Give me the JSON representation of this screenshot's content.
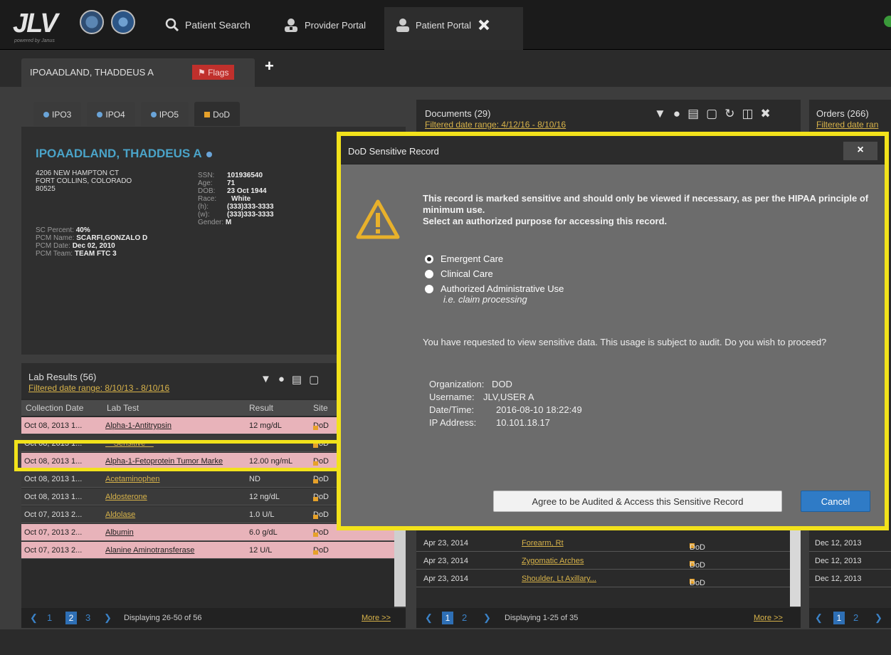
{
  "app": {
    "logo": "JLV",
    "logo_sub": "powered by Janus"
  },
  "nav": {
    "patient_search": "Patient Search",
    "provider_portal": "Provider Portal",
    "patient_portal": "Patient Portal"
  },
  "patient_tab": {
    "name": "IPOAADLAND, THADDEUS A",
    "flags": "Flags"
  },
  "source_tabs": [
    {
      "label": "IPO3"
    },
    {
      "label": "IPO4"
    },
    {
      "label": "IPO5"
    },
    {
      "label": "DoD"
    }
  ],
  "demographics": {
    "name": "IPOAADLAND, THADDEUS A",
    "address1": "4206 NEW HAMPTON CT",
    "address2": "FORT COLLINS, COLORADO",
    "zip": "80525",
    "ssn_label": "SSN:",
    "ssn": "101936540",
    "age_label": "Age:",
    "age": "71",
    "dob_label": "DOB:",
    "dob": "23 Oct 1944",
    "race_label": "Race:",
    "race": "White",
    "h_label": "(h):",
    "h": "(333)333-3333",
    "w_label": "(w):",
    "w": "(333)333-3333",
    "gender_label": "Gender:",
    "gender": "M",
    "sc_label": "SC Percent:",
    "sc": "40%",
    "pcm_name_label": "PCM Name:",
    "pcm_name": "SCARFI,GONZALO D",
    "pcm_date_label": "PCM Date:",
    "pcm_date": "Dec 02, 2010",
    "pcm_team_label": "PCM Team:",
    "pcm_team": "TEAM FTC 3"
  },
  "lab": {
    "title": "Lab Results (56)",
    "filter": "Filtered date range: 8/10/13 - 8/10/16",
    "columns": [
      "Collection Date",
      "Lab Test",
      "Result",
      "Site"
    ],
    "rows": [
      {
        "date": "Oct 08, 2013 1...",
        "test": "Alpha-1-Antitrypsin",
        "result": "12 mg/dL",
        "site": "DoD",
        "style": "pink"
      },
      {
        "date": "Oct 08, 2013 1...",
        "test": "** Sensitive **",
        "result": "",
        "site": "DoD",
        "style": "dark"
      },
      {
        "date": "Oct 08, 2013 1...",
        "test": "Alpha-1-Fetoprotein Tumor Marke",
        "result": "12.00 ng/mL",
        "site": "DoD",
        "style": "pink"
      },
      {
        "date": "Oct 08, 2013 1...",
        "test": "Acetaminophen",
        "result": "ND",
        "site": "DoD",
        "style": "dark"
      },
      {
        "date": "Oct 08, 2013 1...",
        "test": "Aldosterone",
        "result": "12 ng/dL",
        "site": "DoD",
        "style": "dark"
      },
      {
        "date": "Oct 07, 2013 2...",
        "test": "Aldolase",
        "result": "1.0 U/L",
        "site": "DoD",
        "style": "dark"
      },
      {
        "date": "Oct 07, 2013 2...",
        "test": "Albumin",
        "result": "6.0 g/dL",
        "site": "DoD",
        "style": "pink"
      },
      {
        "date": "Oct 07, 2013 2...",
        "test": "Alanine Aminotransferase",
        "result": "12 U/L",
        "site": "DoD",
        "style": "pink"
      }
    ],
    "pager": {
      "p1": "1",
      "p2": "2",
      "p3": "3",
      "display": "Displaying 26-50 of 56",
      "more": "More >>"
    }
  },
  "documents": {
    "title": "Documents (29)",
    "filter": "Filtered date range: 4/12/16 - 8/10/16",
    "rows": [
      {
        "date": "Apr 23, 2014",
        "name": "Forearm, Rt",
        "site": "DoD"
      },
      {
        "date": "Apr 23, 2014",
        "name": "Zygomatic Arches",
        "site": "DoD"
      },
      {
        "date": "Apr 23, 2014",
        "name": "Shoulder, Lt Axillary...",
        "site": "DoD"
      }
    ],
    "pager": {
      "p1": "1",
      "p2": "2",
      "display": "Displaying 1-25 of 35",
      "more": "More >>"
    }
  },
  "orders": {
    "title": "Orders (266)",
    "filter": "Filtered date ran",
    "rows": [
      "Dec 12, 2013",
      "Dec 12, 2013",
      "Dec 12, 2013"
    ],
    "pager": {
      "p1": "1",
      "p2": "2"
    }
  },
  "modal": {
    "title": "DoD Sensitive Record",
    "close": "×",
    "message1": "This record is marked sensitive and should only be viewed if necessary, as per the HIPAA principle of minimum use.",
    "message2": "Select an authorized purpose for accessing this record.",
    "options": [
      "Emergent Care",
      "Clinical Care",
      "Authorized Administrative Use"
    ],
    "option_note": "i.e. claim processing",
    "audit": "You have requested to view sensitive data. This usage is subject to audit. Do you wish to proceed?",
    "info": {
      "org_label": "Organization:",
      "org": "DOD",
      "user_label": "Username:",
      "user": "JLV,USER A",
      "dt_label": "Date/Time:",
      "dt": "2016-08-10 18:22:49",
      "ip_label": "IP Address:",
      "ip": "10.101.18.17"
    },
    "agree": "Agree to be Audited & Access this Sensitive Record",
    "cancel": "Cancel"
  },
  "colors": {
    "highlight": "#f2e21b",
    "accent": "#2f7bc6",
    "dod": "#e6a12a",
    "link": "#d8b34a"
  }
}
